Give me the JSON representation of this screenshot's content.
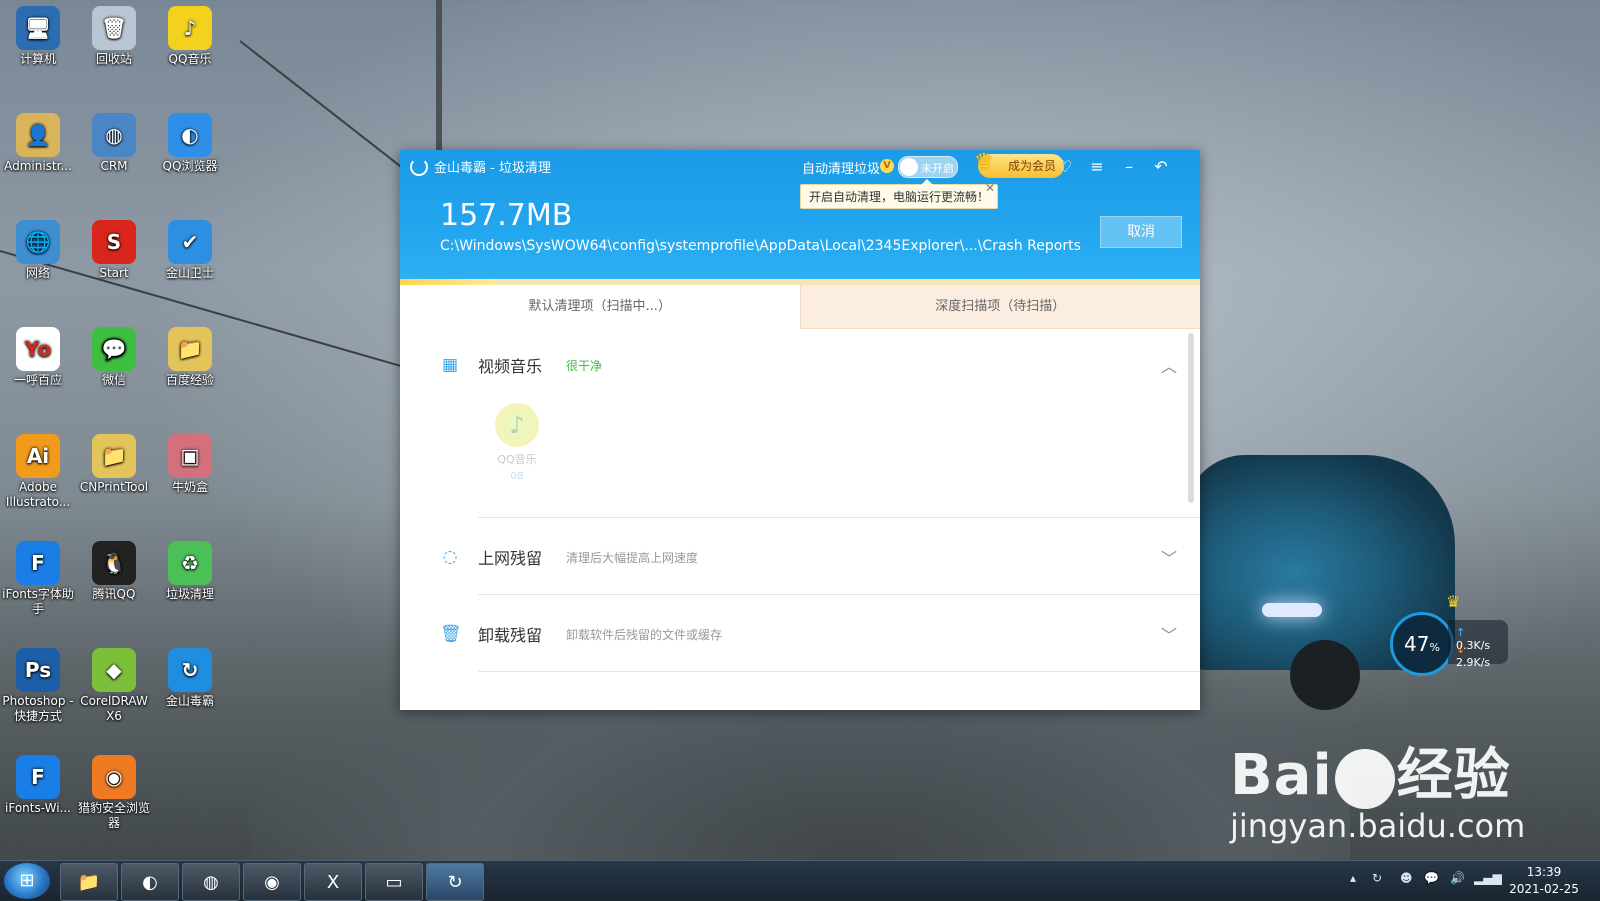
{
  "desktop": {
    "icons": [
      {
        "label": "计算机",
        "icon": "computer-icon",
        "glyph": "🖥",
        "color": "#2b6db0"
      },
      {
        "label": "回收站",
        "icon": "recycle-bin-icon",
        "glyph": "🗑",
        "color": "#b8c6d3"
      },
      {
        "label": "QQ音乐",
        "icon": "qq-music-icon",
        "glyph": "♪",
        "color": "#f3d21e"
      },
      {
        "label": "Administr...",
        "icon": "user-folder-icon",
        "glyph": "👤",
        "color": "#d9b45a"
      },
      {
        "label": "CRM",
        "icon": "globe-icon",
        "glyph": "◍",
        "color": "#4a86c6"
      },
      {
        "label": "QQ浏览器",
        "icon": "qq-browser-icon",
        "glyph": "◐",
        "color": "#2e8fe8"
      },
      {
        "label": "网络",
        "icon": "network-icon",
        "glyph": "🌐",
        "color": "#3d8fd1"
      },
      {
        "label": "Start",
        "icon": "start-app-icon",
        "glyph": "S",
        "color": "#d9261c"
      },
      {
        "label": "金山卫士",
        "icon": "shield-icon",
        "glyph": "✔",
        "color": "#2d8fe2"
      },
      {
        "label": "一呼百应",
        "icon": "document-icon",
        "glyph": "Yo",
        "color": "#ffffff"
      },
      {
        "label": "微信",
        "icon": "wechat-icon",
        "glyph": "💬",
        "color": "#3fbf3f"
      },
      {
        "label": "百度经验",
        "icon": "folder-icon",
        "glyph": "📁",
        "color": "#e3c45a"
      },
      {
        "label": "Adobe Illustrato...",
        "icon": "illustrator-icon",
        "glyph": "Ai",
        "color": "#f29a1a"
      },
      {
        "label": "CNPrintTool",
        "icon": "folder-icon",
        "glyph": "📁",
        "color": "#e3c45a"
      },
      {
        "label": "牛奶盒",
        "icon": "milk-box-icon",
        "glyph": "▣",
        "color": "#d4707b"
      },
      {
        "label": "iFonts字体助手",
        "icon": "ifonts-icon",
        "glyph": "F",
        "color": "#1a7ee6"
      },
      {
        "label": "腾讯QQ",
        "icon": "qq-icon",
        "glyph": "🐧",
        "color": "#222222"
      },
      {
        "label": "垃圾清理",
        "icon": "cleanup-icon",
        "glyph": "♻",
        "color": "#4bbf58"
      },
      {
        "label": "Photoshop - 快捷方式",
        "icon": "photoshop-icon",
        "glyph": "Ps",
        "color": "#1c5fa8"
      },
      {
        "label": "CorelDRAW X6",
        "icon": "coreldraw-icon",
        "glyph": "◆",
        "color": "#7bbf3a"
      },
      {
        "label": "金山毒霸",
        "icon": "duba-icon",
        "glyph": "↻",
        "color": "#1f8ee0"
      },
      {
        "label": "iFonts-Wi...",
        "icon": "ifonts-icon",
        "glyph": "F",
        "color": "#1a7ee6"
      },
      {
        "label": "猎豹安全浏览器",
        "icon": "cheetah-browser-icon",
        "glyph": "◉",
        "color": "#f07a22"
      }
    ]
  },
  "window": {
    "title": "金山毒霸 - 垃圾清理",
    "auto_clean_label": "自动清理垃圾",
    "auto_clean_badge": "V",
    "toggle_state": "未开启",
    "vip_label": "成为会员",
    "tooltip": "开启自动清理，电脑运行更流畅！",
    "scanned_size": "157.7MB",
    "current_path": "C:\\Windows\\SysWOW64\\config\\systemprofile\\AppData\\Local\\2345Explorer\\...\\Crash Reports",
    "cancel_label": "取消",
    "progress_fraction": 0.12,
    "tabs": [
      {
        "label": "默认清理项（扫描中...）",
        "active": true
      },
      {
        "label": "深度扫描项（待扫描）",
        "active": false
      }
    ],
    "categories": [
      {
        "name": "视频音乐",
        "status": "很干净",
        "desc": "",
        "icon": "film-icon",
        "expanded": true
      },
      {
        "name": "上网残留",
        "status": "",
        "desc": "清理后大幅提高上网速度",
        "icon": "loading-icon",
        "expanded": false
      },
      {
        "name": "卸载残留",
        "status": "",
        "desc": "卸载软件后残留的文件或缓存",
        "icon": "trash-icon",
        "expanded": false
      }
    ],
    "app_item": {
      "name": "QQ音乐",
      "size": "0B"
    }
  },
  "speed_widget": {
    "percent": "47",
    "percent_unit": "%",
    "upload": "0.3K/s",
    "download": "2.9K/s"
  },
  "taskbar": {
    "items": [
      {
        "icon": "file-explorer-icon",
        "glyph": "📁"
      },
      {
        "icon": "qq-browser-icon",
        "glyph": "◐"
      },
      {
        "icon": "globe-icon",
        "glyph": "◍"
      },
      {
        "icon": "cheetah-browser-icon",
        "glyph": "◉"
      },
      {
        "icon": "excel-icon",
        "glyph": "X"
      },
      {
        "icon": "photo-viewer-icon",
        "glyph": "▭"
      },
      {
        "icon": "duba-icon",
        "glyph": "↻"
      }
    ],
    "time": "13:39",
    "date": "2021-02-25"
  },
  "watermark": {
    "main_left": "Bai",
    "main_right": "经验",
    "sub": "jingyan.baidu.com"
  }
}
